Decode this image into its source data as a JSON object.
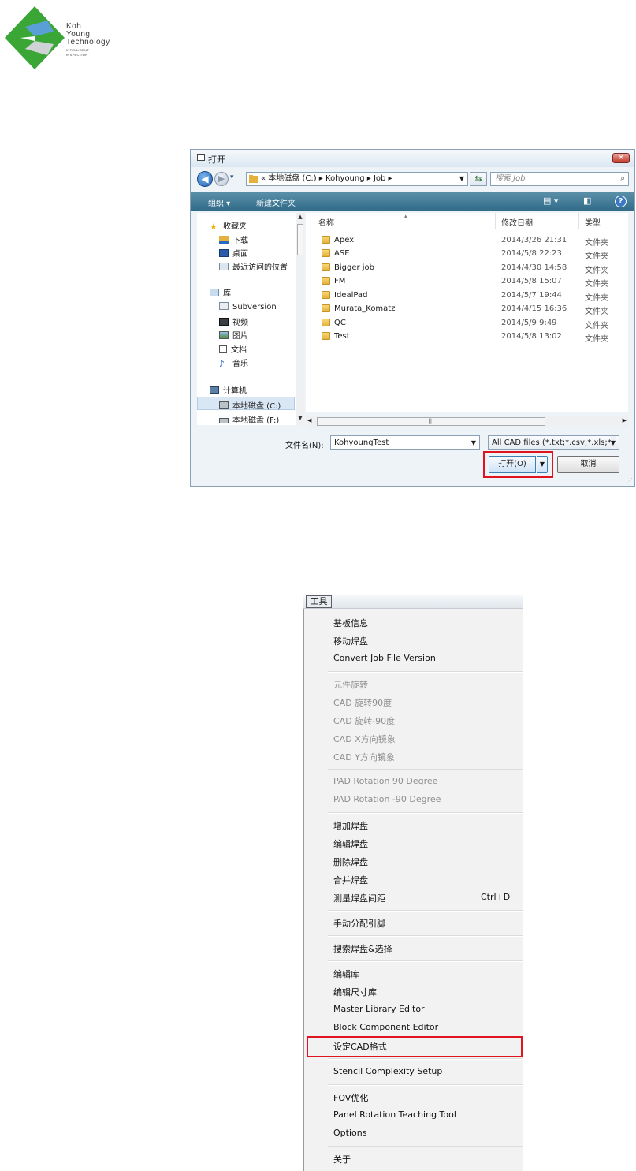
{
  "logo": {
    "line1": "Koh",
    "line2": "Young",
    "line3": "Technology",
    "line4": "INTELLIGENT",
    "line5": "INSPECTION",
    "green": "#3aa635",
    "blue": "#5aa0d6"
  },
  "dialog": {
    "title": "打开",
    "close_glyph": "✕",
    "address": {
      "crumbs": "«  本地磁盘 (C:)  ▸  Kohyoung  ▸  Job  ▸"
    },
    "search_placeholder": "搜索 Job",
    "toolbar": {
      "organize": "组织 ▾",
      "new_folder": "新建文件夹"
    },
    "nav": {
      "favorites": "收藏夹",
      "downloads": "下载",
      "desktop": "桌面",
      "recent": "最近访问的位置",
      "libraries": "库",
      "subversion": "Subversion",
      "videos": "视频",
      "pictures": "图片",
      "documents": "文档",
      "music": "音乐",
      "computer": "计算机",
      "drive_c": "本地磁盘 (C:)",
      "drive_f": "本地磁盘 (F:)"
    },
    "columns": {
      "name": "名称",
      "date": "修改日期",
      "type": "类型"
    },
    "files": [
      {
        "name": "Apex",
        "date": "2014/3/26 21:31",
        "type": "文件夹"
      },
      {
        "name": "ASE",
        "date": "2014/5/8 22:23",
        "type": "文件夹"
      },
      {
        "name": "Bigger job",
        "date": "2014/4/30 14:58",
        "type": "文件夹"
      },
      {
        "name": "FM",
        "date": "2014/5/8 15:07",
        "type": "文件夹"
      },
      {
        "name": "IdealPad",
        "date": "2014/5/7 19:44",
        "type": "文件夹"
      },
      {
        "name": "Murata_Komatz",
        "date": "2014/4/15 16:36",
        "type": "文件夹"
      },
      {
        "name": "QC",
        "date": "2014/5/9 9:49",
        "type": "文件夹"
      },
      {
        "name": "Test",
        "date": "2014/5/8 13:02",
        "type": "文件夹"
      }
    ],
    "filename_label": "文件名(N):",
    "filename_value": "KohyoungTest",
    "filter_value": "All CAD files (*.txt;*.csv;*.xls;*",
    "open_label": "打开(O)",
    "cancel_label": "取消"
  },
  "menu": {
    "title": "工具",
    "items": [
      {
        "label": "基板信息",
        "disabled": false
      },
      {
        "label": "移动焊盘",
        "disabled": false
      },
      {
        "label": "Convert Job File Version",
        "disabled": false
      },
      {
        "label": "元件旋转",
        "disabled": true
      },
      {
        "label": "CAD 旋转90度",
        "disabled": true
      },
      {
        "label": "CAD 旋转-90度",
        "disabled": true
      },
      {
        "label": "CAD X方向镜象",
        "disabled": true
      },
      {
        "label": "CAD Y方向镜象",
        "disabled": true
      },
      {
        "label": "PAD Rotation 90 Degree",
        "disabled": true
      },
      {
        "label": "PAD Rotation -90 Degree",
        "disabled": true
      },
      {
        "label": "增加焊盘",
        "disabled": false
      },
      {
        "label": "编辑焊盘",
        "disabled": false
      },
      {
        "label": "删除焊盘",
        "disabled": false
      },
      {
        "label": "合并焊盘",
        "disabled": false
      },
      {
        "label": "测量焊盘间距",
        "disabled": false,
        "shortcut": "Ctrl+D"
      },
      {
        "label": "手动分配引脚",
        "disabled": false
      },
      {
        "label": "搜索焊盘&选择",
        "disabled": false
      },
      {
        "label": "编辑库",
        "disabled": false
      },
      {
        "label": "编辑尺寸库",
        "disabled": false
      },
      {
        "label": "Master Library Editor",
        "disabled": false
      },
      {
        "label": "Block Component Editor",
        "disabled": false
      },
      {
        "label": "设定CAD格式",
        "disabled": false
      },
      {
        "label": "Stencil Complexity Setup",
        "disabled": false
      },
      {
        "label": "FOV优化",
        "disabled": false
      },
      {
        "label": "Panel Rotation Teaching Tool",
        "disabled": false
      },
      {
        "label": "Options",
        "disabled": false
      },
      {
        "label": "关于",
        "disabled": false
      }
    ]
  },
  "colors": {
    "highlight": "#e0141e",
    "toolbar": "#2f6a88",
    "disabled": "#8e8e8e"
  }
}
